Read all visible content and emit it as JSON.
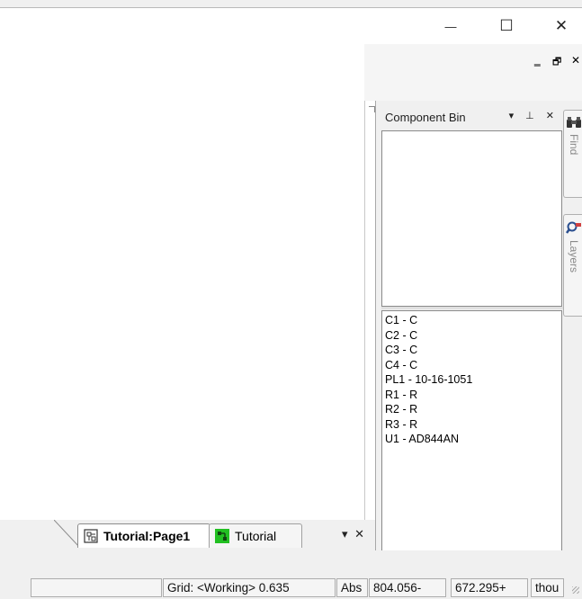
{
  "window": {
    "minimize_glyph": "—",
    "maximize_glyph": "☐",
    "close_glyph": "✕",
    "mdi_minimize_glyph": "‗",
    "mdi_restore_glyph": "🗗",
    "mdi_close_glyph": "✕"
  },
  "component_bin": {
    "title": "Component Bin",
    "controls": "▾ ⊥ ✕",
    "items": [
      "C1 - C",
      "C2 - C",
      "C3 - C",
      "C4 - C",
      "PL1 - 10-16-1051",
      "R1 - R",
      "R2 - R",
      "R3 - R",
      "U1 - AD844AN"
    ]
  },
  "side_tabs": {
    "find": "Find",
    "layers": "Layers"
  },
  "doc_tabs": {
    "tab1_label": "Tutorial:Page1",
    "tab2_label": "Tutorial",
    "controls": "▾ ✕"
  },
  "status_bar": {
    "grid": "Grid: <Working> 0.635",
    "abs": "Abs",
    "x": "804.056-",
    "y": "672.295+",
    "units": "thou"
  },
  "colors": {
    "pcb_icon_green": "#22c022",
    "border": "#8a8a8a"
  }
}
